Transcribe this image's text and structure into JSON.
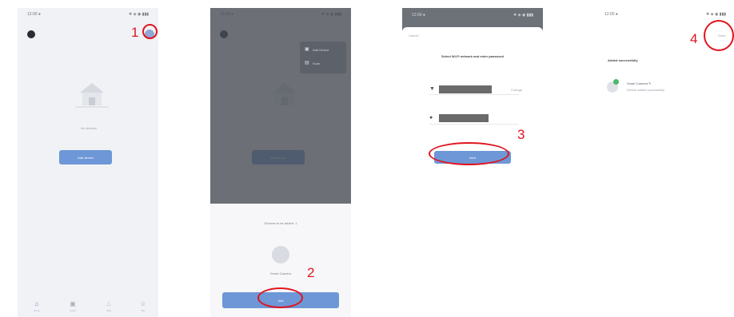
{
  "colors": {
    "accent": "#6d97d6",
    "annotation": "#e0141e",
    "overlay": "#464a52"
  },
  "screen1": {
    "status_time": "12:00 ●",
    "status_icons": "❖ ◈ ◉ ▮▮▮",
    "logo_icon": "tuya-logo-icon",
    "add_icon": "plus-circle-icon",
    "empty_text": "No devices",
    "add_button": "Add device",
    "nav": [
      {
        "icon": "⌂",
        "label": "Home"
      },
      {
        "icon": "▣",
        "label": "Smart"
      },
      {
        "icon": "♨",
        "label": "Mall"
      },
      {
        "icon": "☺",
        "label": "Me"
      }
    ],
    "step_label": "1"
  },
  "screen2": {
    "menu": [
      {
        "icon": "▣",
        "label": "Add Device"
      },
      {
        "icon": "▤",
        "label": "Scan"
      }
    ],
    "sheet_title": "Devices to be added: 1",
    "device_label": "Smart Camera",
    "add_button": "Add",
    "step_label": "2"
  },
  "screen3": {
    "cancel_label": "Cancel",
    "title": "Select Wi-Fi network and enter password",
    "change_label": "Change",
    "next_button": "Next",
    "step_label": "3"
  },
  "screen4": {
    "done_label": "Done",
    "title": "Added successfully",
    "device_name": "Smart Camera  ✎",
    "device_sub": "Device added successfully",
    "step_label": "4"
  }
}
